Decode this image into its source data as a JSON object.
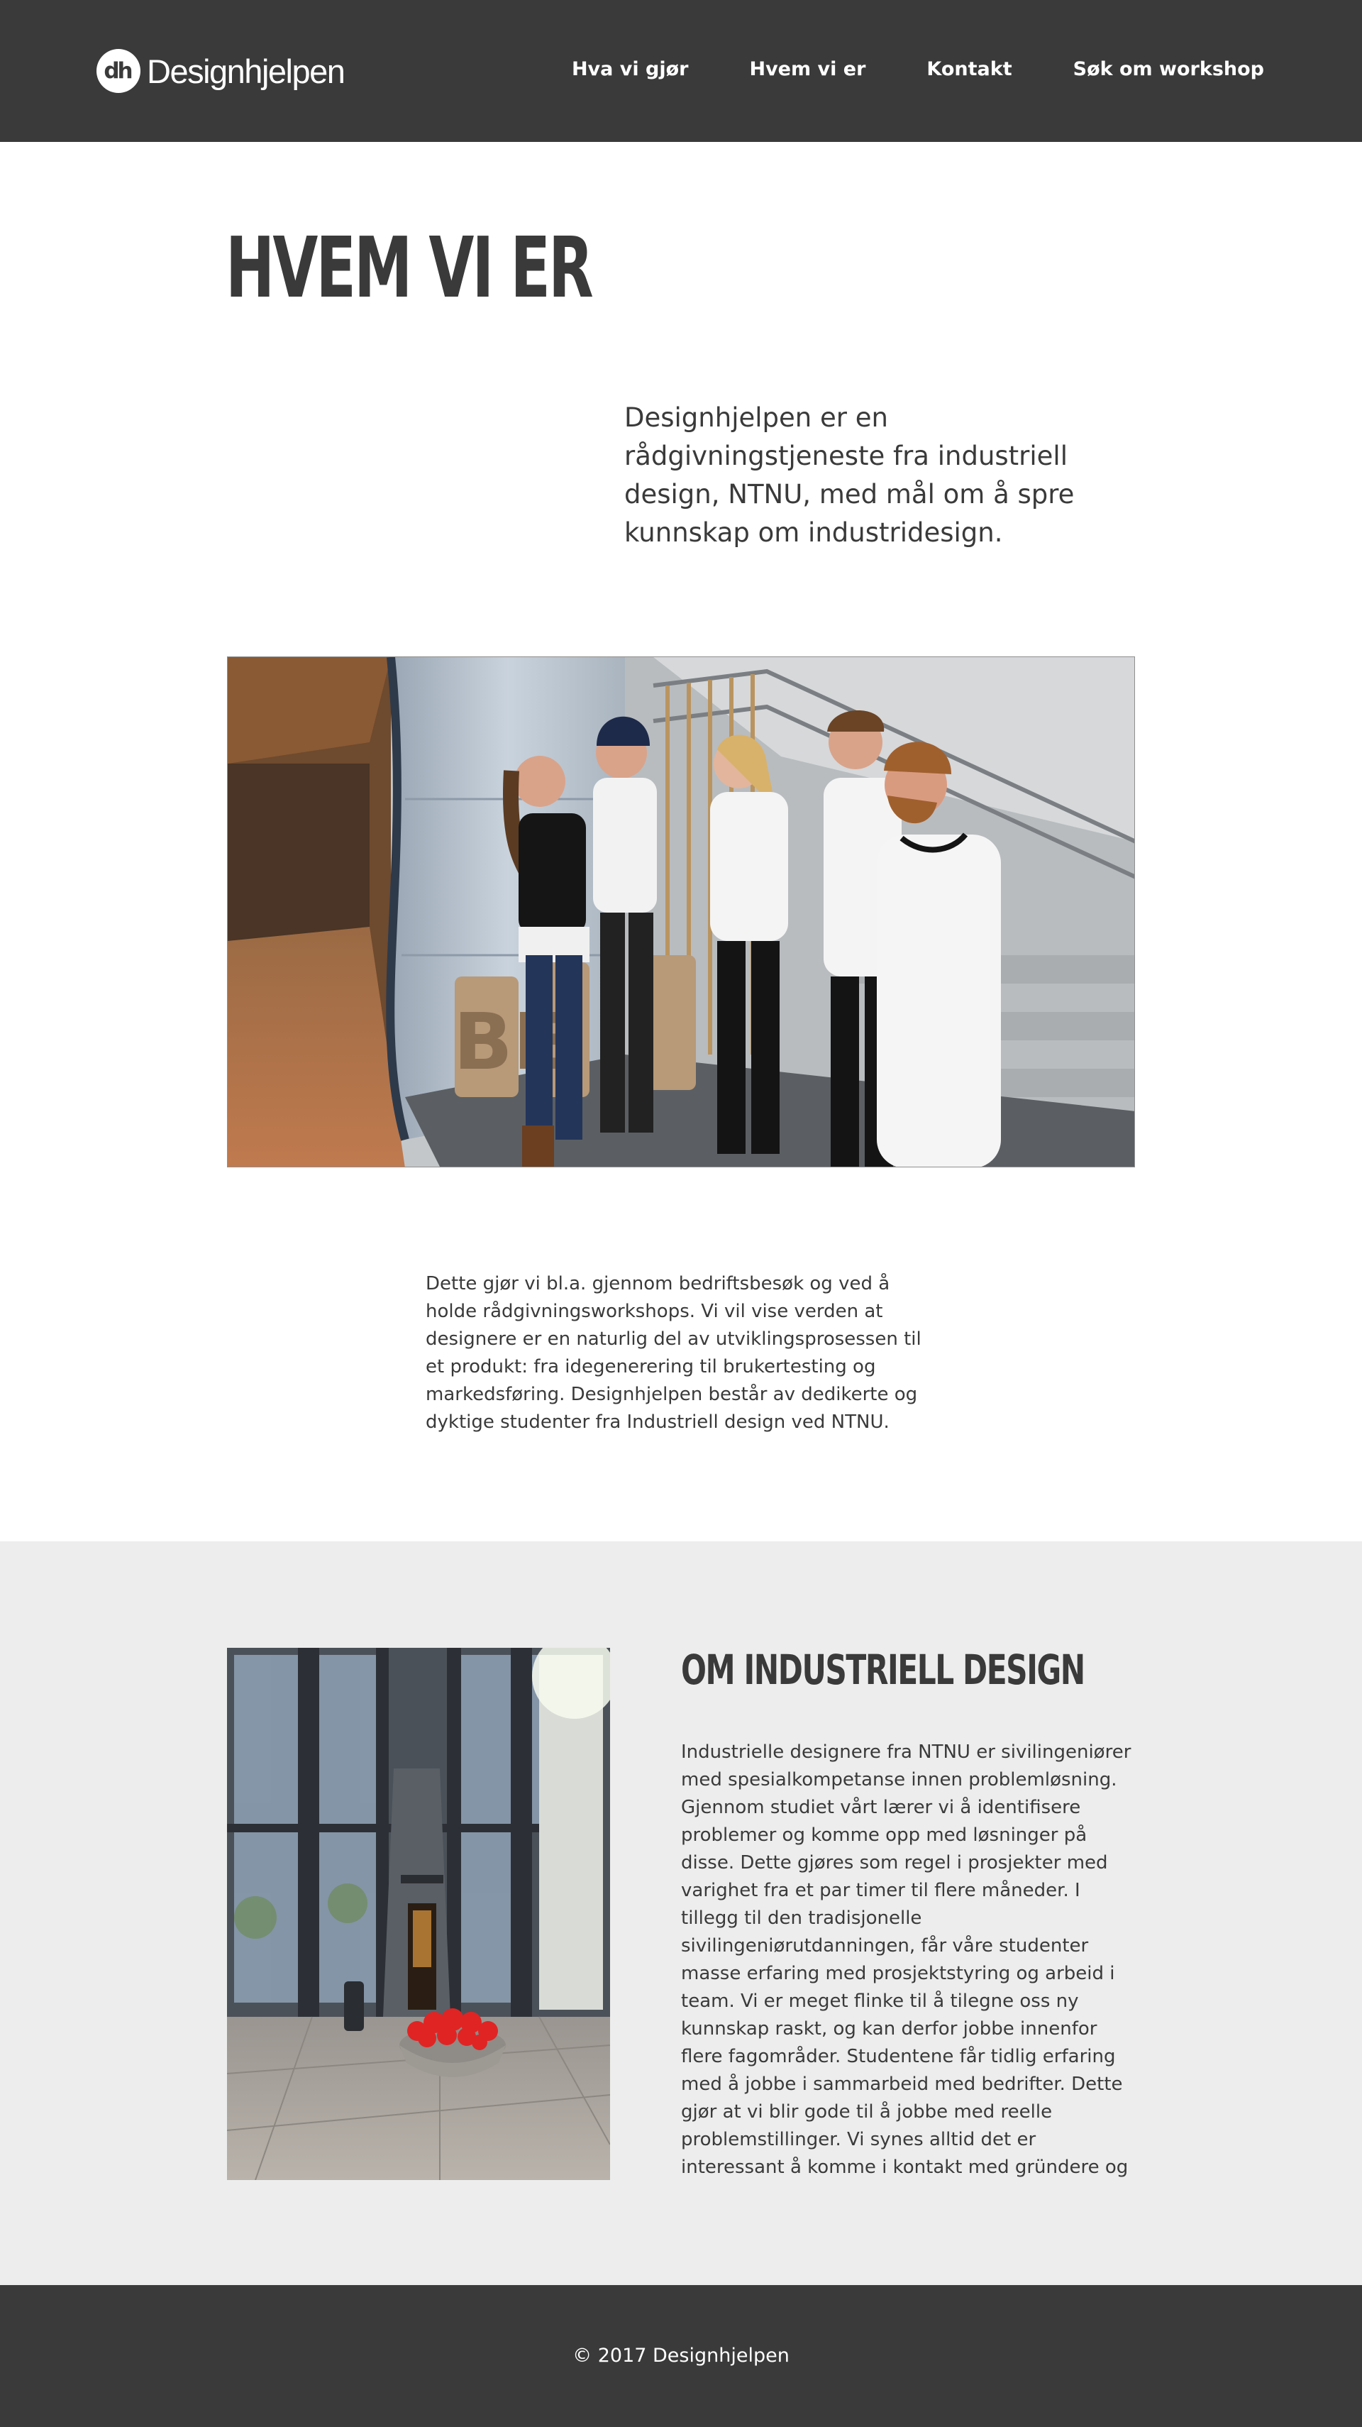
{
  "header": {
    "logo_mark": "dh",
    "logo_text": "Designhjelpen",
    "nav": [
      {
        "label": "Hva vi gjør"
      },
      {
        "label": "Hvem vi er"
      },
      {
        "label": "Kontakt"
      },
      {
        "label": "Søk om workshop"
      }
    ]
  },
  "hero": {
    "title": "HVEM VI ER",
    "intro": "Designhjelpen er en rådgivningstjeneste fra industriell design, NTNU, med mål om å spre kunnskap om industridesign."
  },
  "photos": {
    "team_photo_text": "BE"
  },
  "main": {
    "body": "Dette gjør vi bl.a. gjennom bedriftsbesøk og ved å holde rådgivningsworkshops. Vi vil vise verden at designere er en naturlig del av utviklingsprosessen til et produkt: fra idegenerering til brukertesting og markedsføring. Designhjelpen består av dedikerte og dyktige studenter fra Industriell design ved NTNU."
  },
  "about": {
    "title": "OM INDUSTRIELL DESIGN",
    "body": "Industrielle designere fra NTNU er sivilingeniører med spesialkompetanse innen problemløsning. Gjennom studiet vårt lærer vi å identifisere problemer og komme opp med løsninger på disse. Dette gjøres som regel i prosjekter med varighet fra et par timer til flere måneder. I tillegg til den tradisjonelle sivilingeniørutdanningen, får våre studenter masse erfaring med prosjektstyring og arbeid i team. Vi er meget flinke til å tilegne oss ny kunnskap raskt, og kan derfor jobbe innenfor flere fagområder. Studentene får tidlig erfaring med å jobbe i sammarbeid med bedrifter. Dette gjør at vi blir gode til å jobbe med reelle problemstillinger. Vi synes alltid det er interessant å komme i kontakt med gründere og"
  },
  "footer": {
    "copyright": "© 2017 Designhjelpen"
  },
  "colors": {
    "header_bg": "#3a3a3a",
    "text": "#3a3a3a",
    "section_bg": "#ededed",
    "flowers": "#e02424"
  }
}
